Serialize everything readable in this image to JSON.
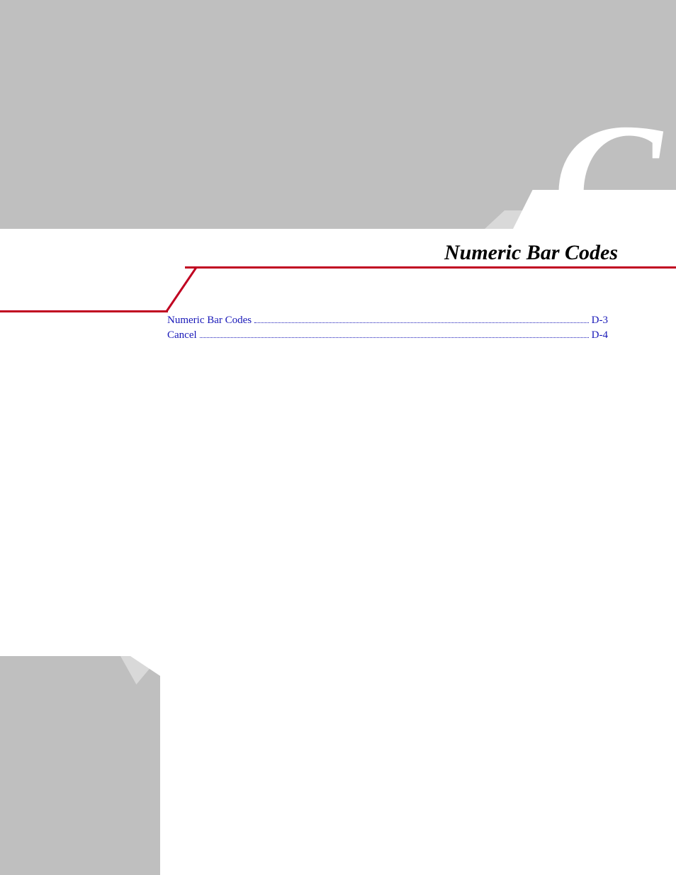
{
  "chapter": {
    "letter": "C",
    "title": "Numeric Bar Codes"
  },
  "toc": [
    {
      "label": "Numeric Bar Codes",
      "page": "D-3"
    },
    {
      "label": "Cancel",
      "page": "D-4"
    }
  ]
}
